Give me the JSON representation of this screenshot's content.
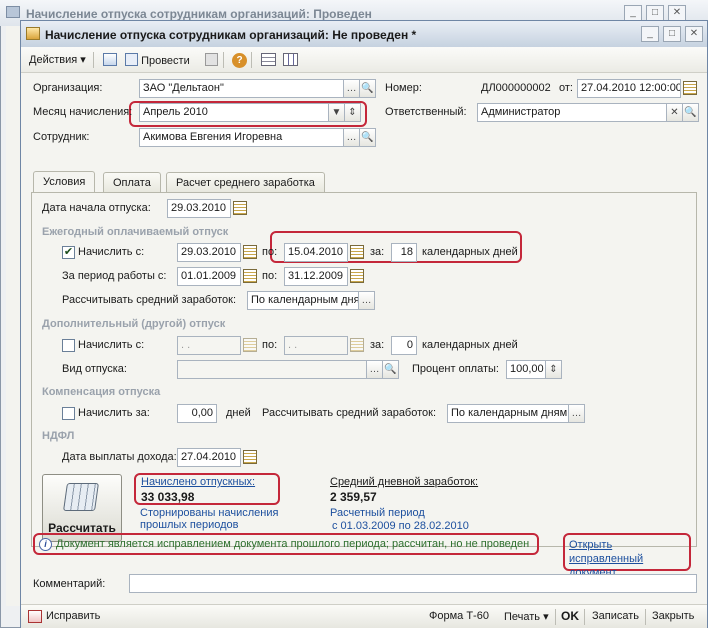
{
  "background_window": {
    "title": "Начисление отпуска сотрудникам организаций: Проведен"
  },
  "window": {
    "title": "Начисление отпуска сотрудникам организаций: Не проведен *"
  },
  "toolbar": {
    "actions_label": "Действия",
    "post_label": "Провести"
  },
  "header": {
    "org_label": "Организация:",
    "org_value": "ЗАО \"Дельтаон\"",
    "number_label": "Номер:",
    "number_value": "ДЛ000000002",
    "date_label": "от:",
    "date_value": "27.04.2010 12:00:00",
    "month_label": "Месяц начисления:",
    "month_value": "Апрель 2010",
    "responsible_label": "Ответственный:",
    "responsible_value": "Администратор",
    "employee_label": "Сотрудник:",
    "employee_value": "Акимова Евгения Игоревна"
  },
  "tabs": [
    {
      "label": "Условия"
    },
    {
      "label": "Оплата"
    },
    {
      "label": "Расчет среднего заработка"
    }
  ],
  "conditions": {
    "start_label": "Дата начала отпуска:",
    "start_value": "29.03.2010",
    "annual_header": "Ежегодный оплачиваемый отпуск",
    "accrue_from_label": "Начислить с:",
    "annual_from": "29.03.2010",
    "to_label": "по:",
    "annual_to": "15.04.2010",
    "for_label": "за:",
    "annual_days": "18",
    "days_unit": "календарных дней",
    "period_label": "За период работы с:",
    "period_from": "01.01.2009",
    "period_to": "31.12.2009",
    "avg_calc_label": "Рассчитывать средний заработок:",
    "avg_calc_value": "По календарным дня",
    "extra_header": "Дополнительный (другой) отпуск",
    "extra_from_label": "Начислить с:",
    "extra_from": " .  .",
    "extra_to_label": "по:",
    "extra_to": " .  .",
    "extra_for_label": "за:",
    "extra_days": "0",
    "extra_days_unit": "календарных дней",
    "vacation_kind_label": "Вид отпуска:",
    "pay_percent_label": "Процент оплаты:",
    "pay_percent_value": "100,00",
    "comp_header": "Компенсация отпуска",
    "comp_label": "Начислить за:",
    "comp_days": "0,00",
    "comp_days_unit": "дней",
    "comp_avg_label": "Рассчитывать средний заработок:",
    "comp_avg_value": "По календарным дням",
    "ndfl_header": "НДФЛ",
    "pay_date_label": "Дата выплаты дохода:",
    "pay_date_value": "27.04.2010"
  },
  "calc": {
    "button_label": "Рассчитать",
    "accrued_label": "Начислено отпускных:",
    "accrued_value": "33 033,98",
    "reversed_link": "Сторнированы начисления прошлых периодов",
    "avg_label": "Средний дневной заработок:",
    "avg_value": "2 359,57",
    "period_line1": "Расчетный период",
    "period_line2": "с 01.03.2009 по 28.02.2010"
  },
  "info": {
    "message": "Документ является исправлением документа прошлого периода; рассчитан, но не проведен",
    "open_link": "Открыть исправленный документ"
  },
  "comment": {
    "label": "Комментарий:",
    "value": ""
  },
  "bottom": {
    "fix_label": "Исправить",
    "form_label": "Форма Т-60",
    "print_label": "Печать",
    "ok_label": "OK",
    "save_label": "Записать",
    "close_label": "Закрыть"
  },
  "colors": {
    "highlight": "#c4273a",
    "link": "#1c4f9e",
    "info_text": "#2d6f2d"
  }
}
